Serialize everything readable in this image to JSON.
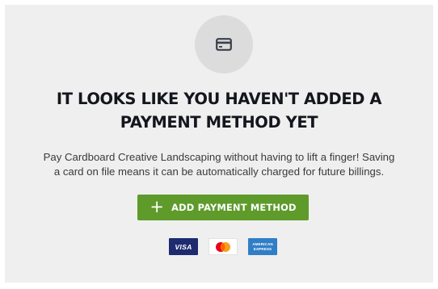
{
  "empty_state": {
    "icon": "credit-card-icon",
    "headline": {
      "line1": "IT LOOKS LIKE YOU HAVEN'T ADDED A",
      "line2": "PAYMENT METHOD YET"
    },
    "description": {
      "line1": "Pay Cardboard Creative Landscaping without having to lift a finger! Saving",
      "line2": "a card on file means it can be automatically charged for future billings."
    },
    "button": {
      "icon": "plus-icon",
      "label": "ADD PAYMENT METHOD"
    },
    "accepted_cards": {
      "visa": "VISA",
      "mastercard": "mastercard-logo",
      "amex": {
        "line1": "AMERICAN",
        "line2": "EXPRESS"
      }
    }
  },
  "colors": {
    "panel_background": "#efefef",
    "icon_circle": "#dcdcdc",
    "headline": "#14161d",
    "button_background": "#5e9b2b",
    "visa_background": "#1f2b6f",
    "amex_background": "#2f7ec7",
    "mastercard_red": "#eb001b",
    "mastercard_orange": "#f79e1b"
  }
}
